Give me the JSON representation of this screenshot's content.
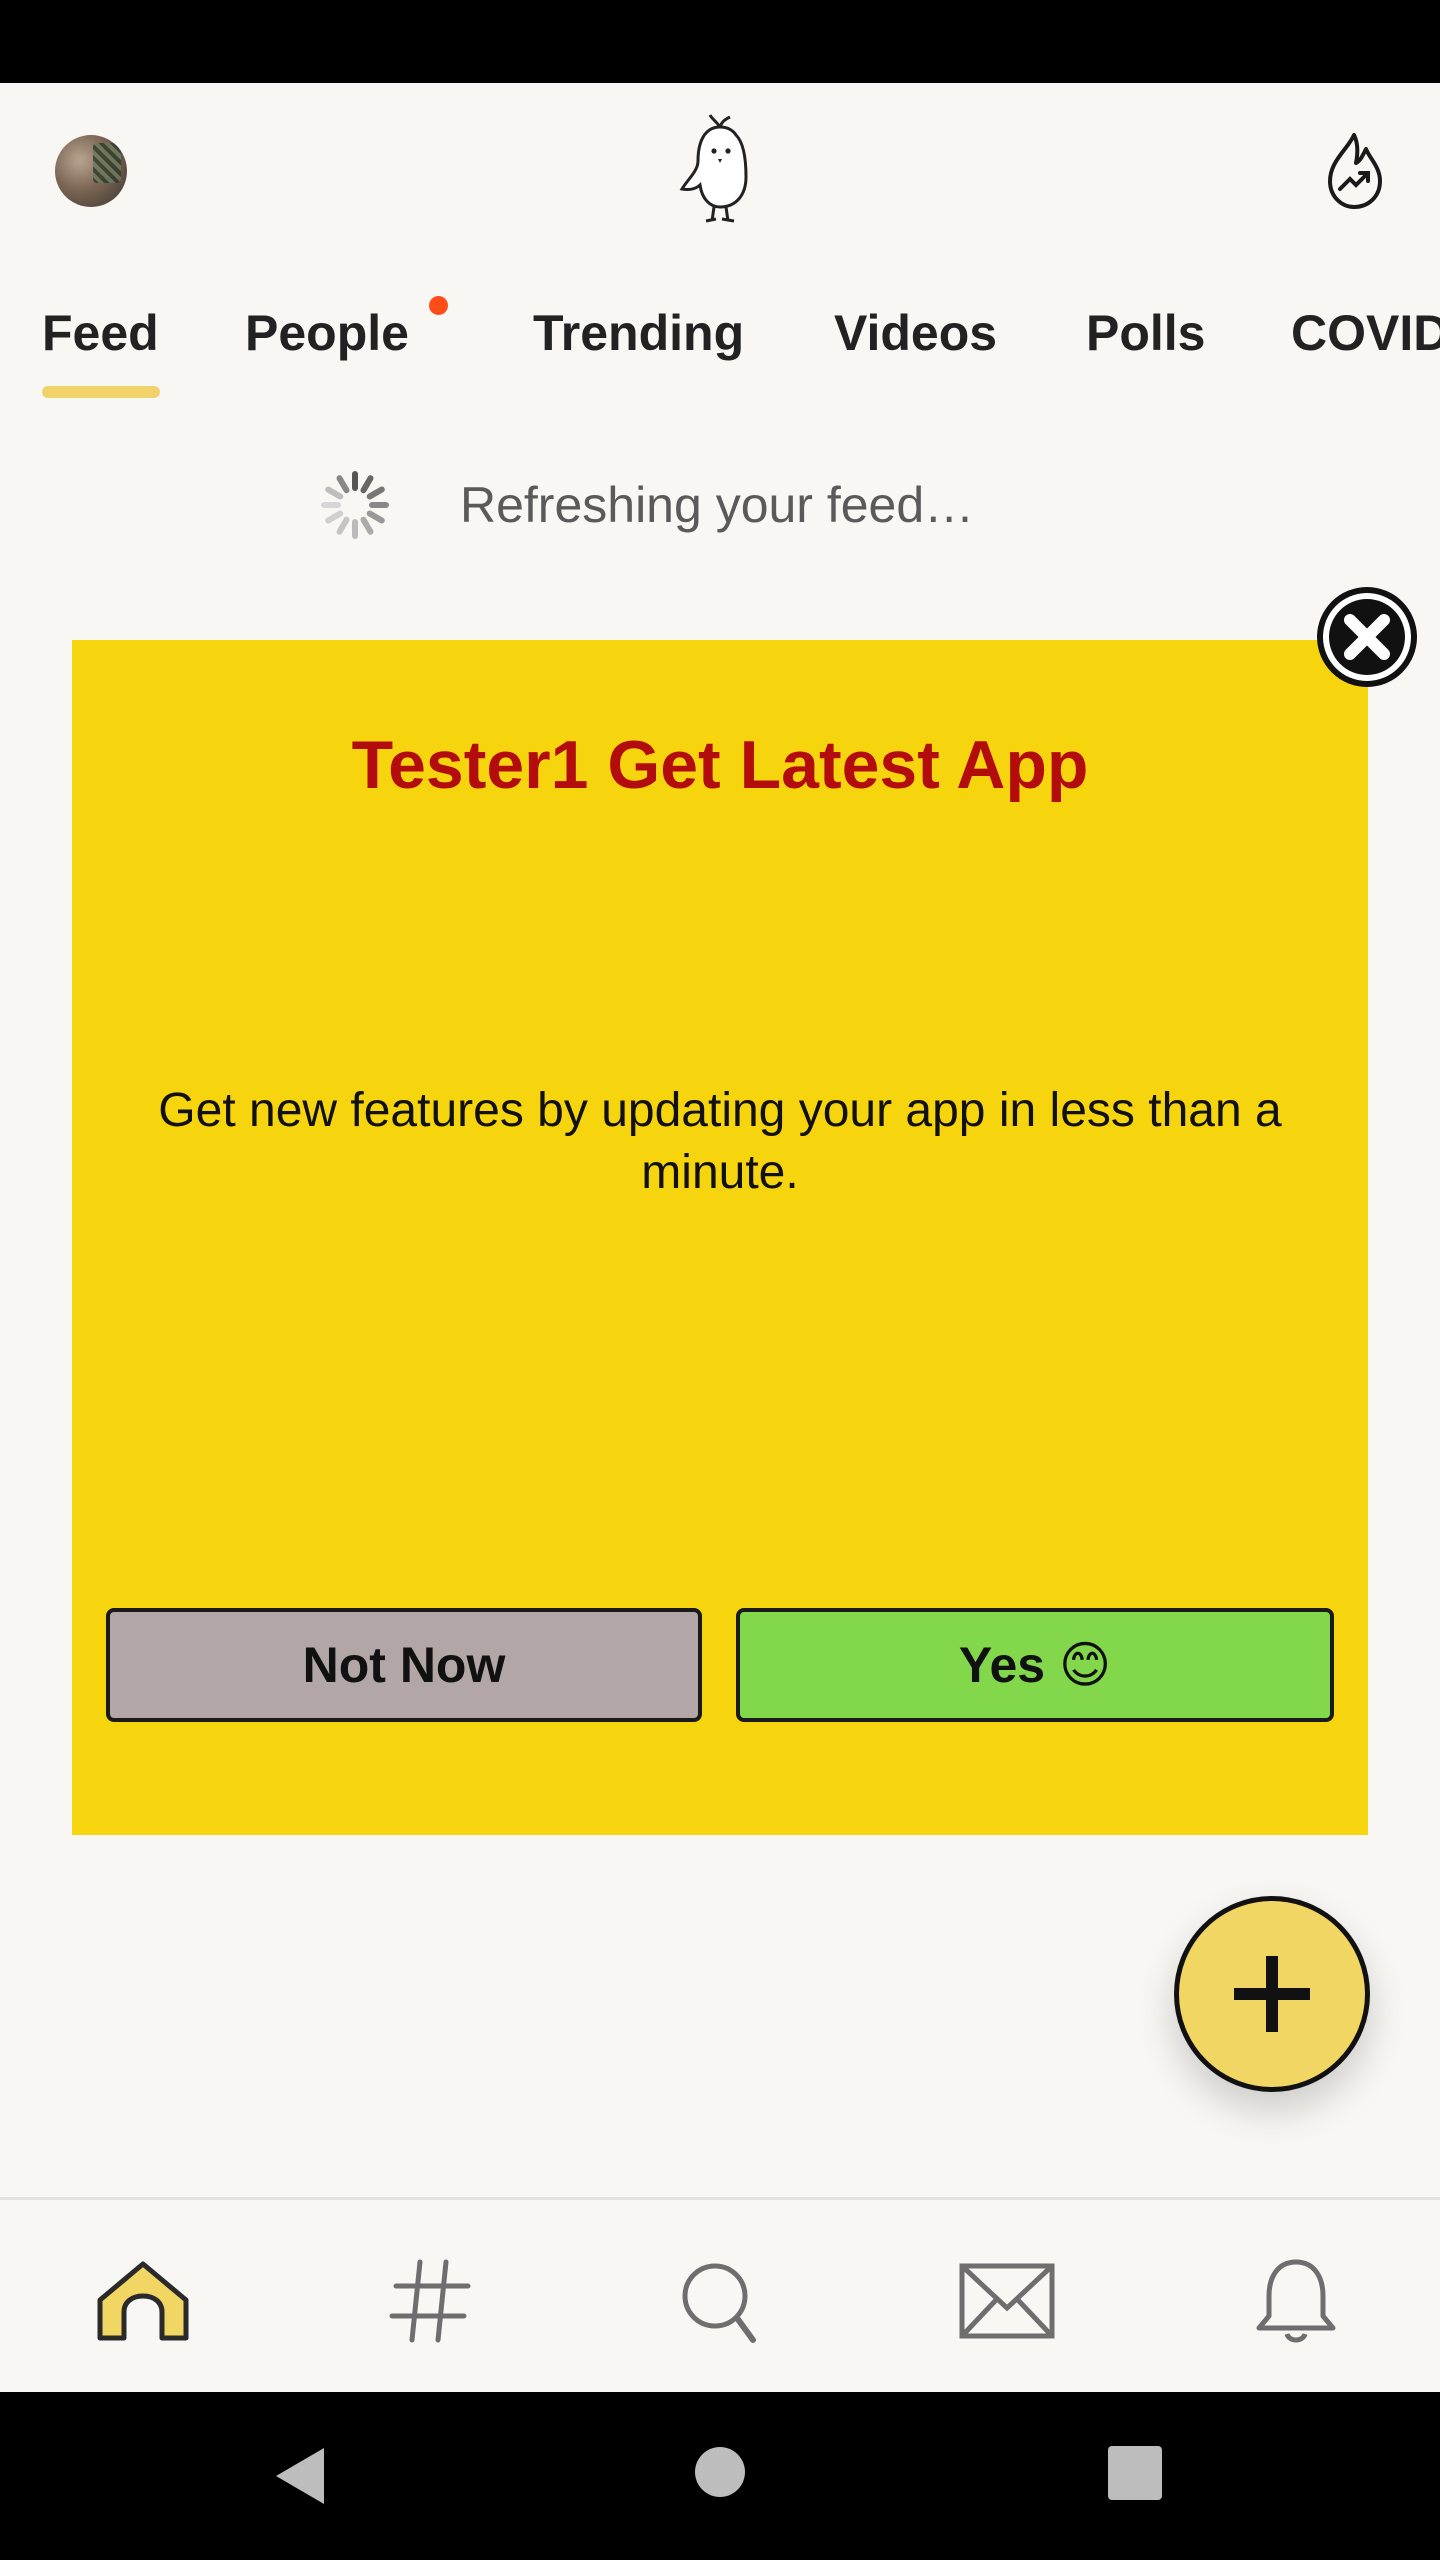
{
  "header": {
    "avatar_icon": "user-avatar",
    "logo_icon": "koo-bird-logo",
    "trending_icon": "flame-trending-icon"
  },
  "tabs": [
    {
      "label": "Feed",
      "active": true
    },
    {
      "label": "People",
      "has_notification": true
    },
    {
      "label": "Trending"
    },
    {
      "label": "Videos"
    },
    {
      "label": "Polls"
    },
    {
      "label": "COVID"
    }
  ],
  "refresh": {
    "text": "Refreshing your feed…"
  },
  "promo": {
    "title": "Tester1 Get Latest App",
    "body": "Get new features by updating your app in less than a minute.",
    "not_now_label": "Not Now",
    "yes_label": "Yes 😊",
    "colors": {
      "background": "#f7d50e",
      "title": "#b30c0c",
      "not_now": "#b3a6a6",
      "yes": "#82d84a"
    }
  },
  "bottom_nav": [
    {
      "icon": "home-icon",
      "active": true
    },
    {
      "icon": "hashtag-icon"
    },
    {
      "icon": "search-icon"
    },
    {
      "icon": "mail-icon"
    },
    {
      "icon": "bell-icon"
    }
  ],
  "system_nav": [
    "back-icon",
    "home-circle-icon",
    "recents-square-icon"
  ],
  "accent_color": "#f2d663"
}
